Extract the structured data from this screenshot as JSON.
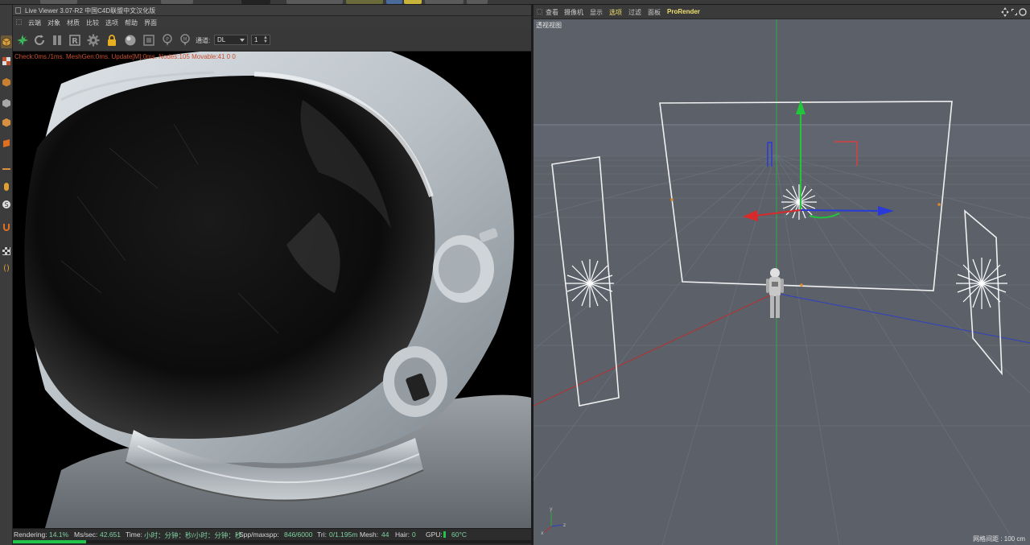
{
  "live_viewer": {
    "title": "Live Viewer 3.07-R2 中国C4D联盟中文汉化版",
    "menu": [
      "云端",
      "对象",
      "材质",
      "比较",
      "选项",
      "帮助",
      "界面"
    ],
    "toolbar": {
      "channel_label": "通道:",
      "channel_value": "DL",
      "pass_value": "1"
    },
    "render_stats": "Check:0ms./1ms. MeshGen:0ms. Update[M]:0ms. Nodes:105 Movable:41  0 0",
    "status": {
      "rendering_label": "Rendering:",
      "rendering_value": "14.1%",
      "mssec_label": "Ms/sec:",
      "mssec_value": "42.651",
      "time_label": "Time:",
      "time_value": "小时：分钟：秒/小时：分钟：秒",
      "spp_label": "Spp/maxspp:",
      "spp_value": "846/6000",
      "tri_label": "Tri:",
      "tri_value": "0/1.195m",
      "mesh_label": "Mesh:",
      "mesh_value": "44",
      "hair_label": "Hair:",
      "hair_value": "0",
      "gpu_label": "GPU:",
      "gpu_temp": "60°C"
    },
    "progress": 0.141
  },
  "viewport": {
    "menu": [
      "查看",
      "摄像机",
      "显示",
      "选项",
      "过滤",
      "面板",
      "ProRender"
    ],
    "active_menu": "选项",
    "label": "透视视图",
    "grid_readout": "网格间距 : 100 cm"
  },
  "colors": {
    "accent_yellow": "#f0e070",
    "progress_green": "#21c44a",
    "stats_orange": "#c85030",
    "viewport_bg": "#5b6069"
  },
  "icons": [
    "render-start-icon",
    "refresh-icon",
    "pause-icon",
    "region-icon",
    "settings-gear-icon",
    "lock-icon",
    "material-ball-icon",
    "clay-render-icon",
    "pin-icon",
    "pin-alt-icon"
  ]
}
